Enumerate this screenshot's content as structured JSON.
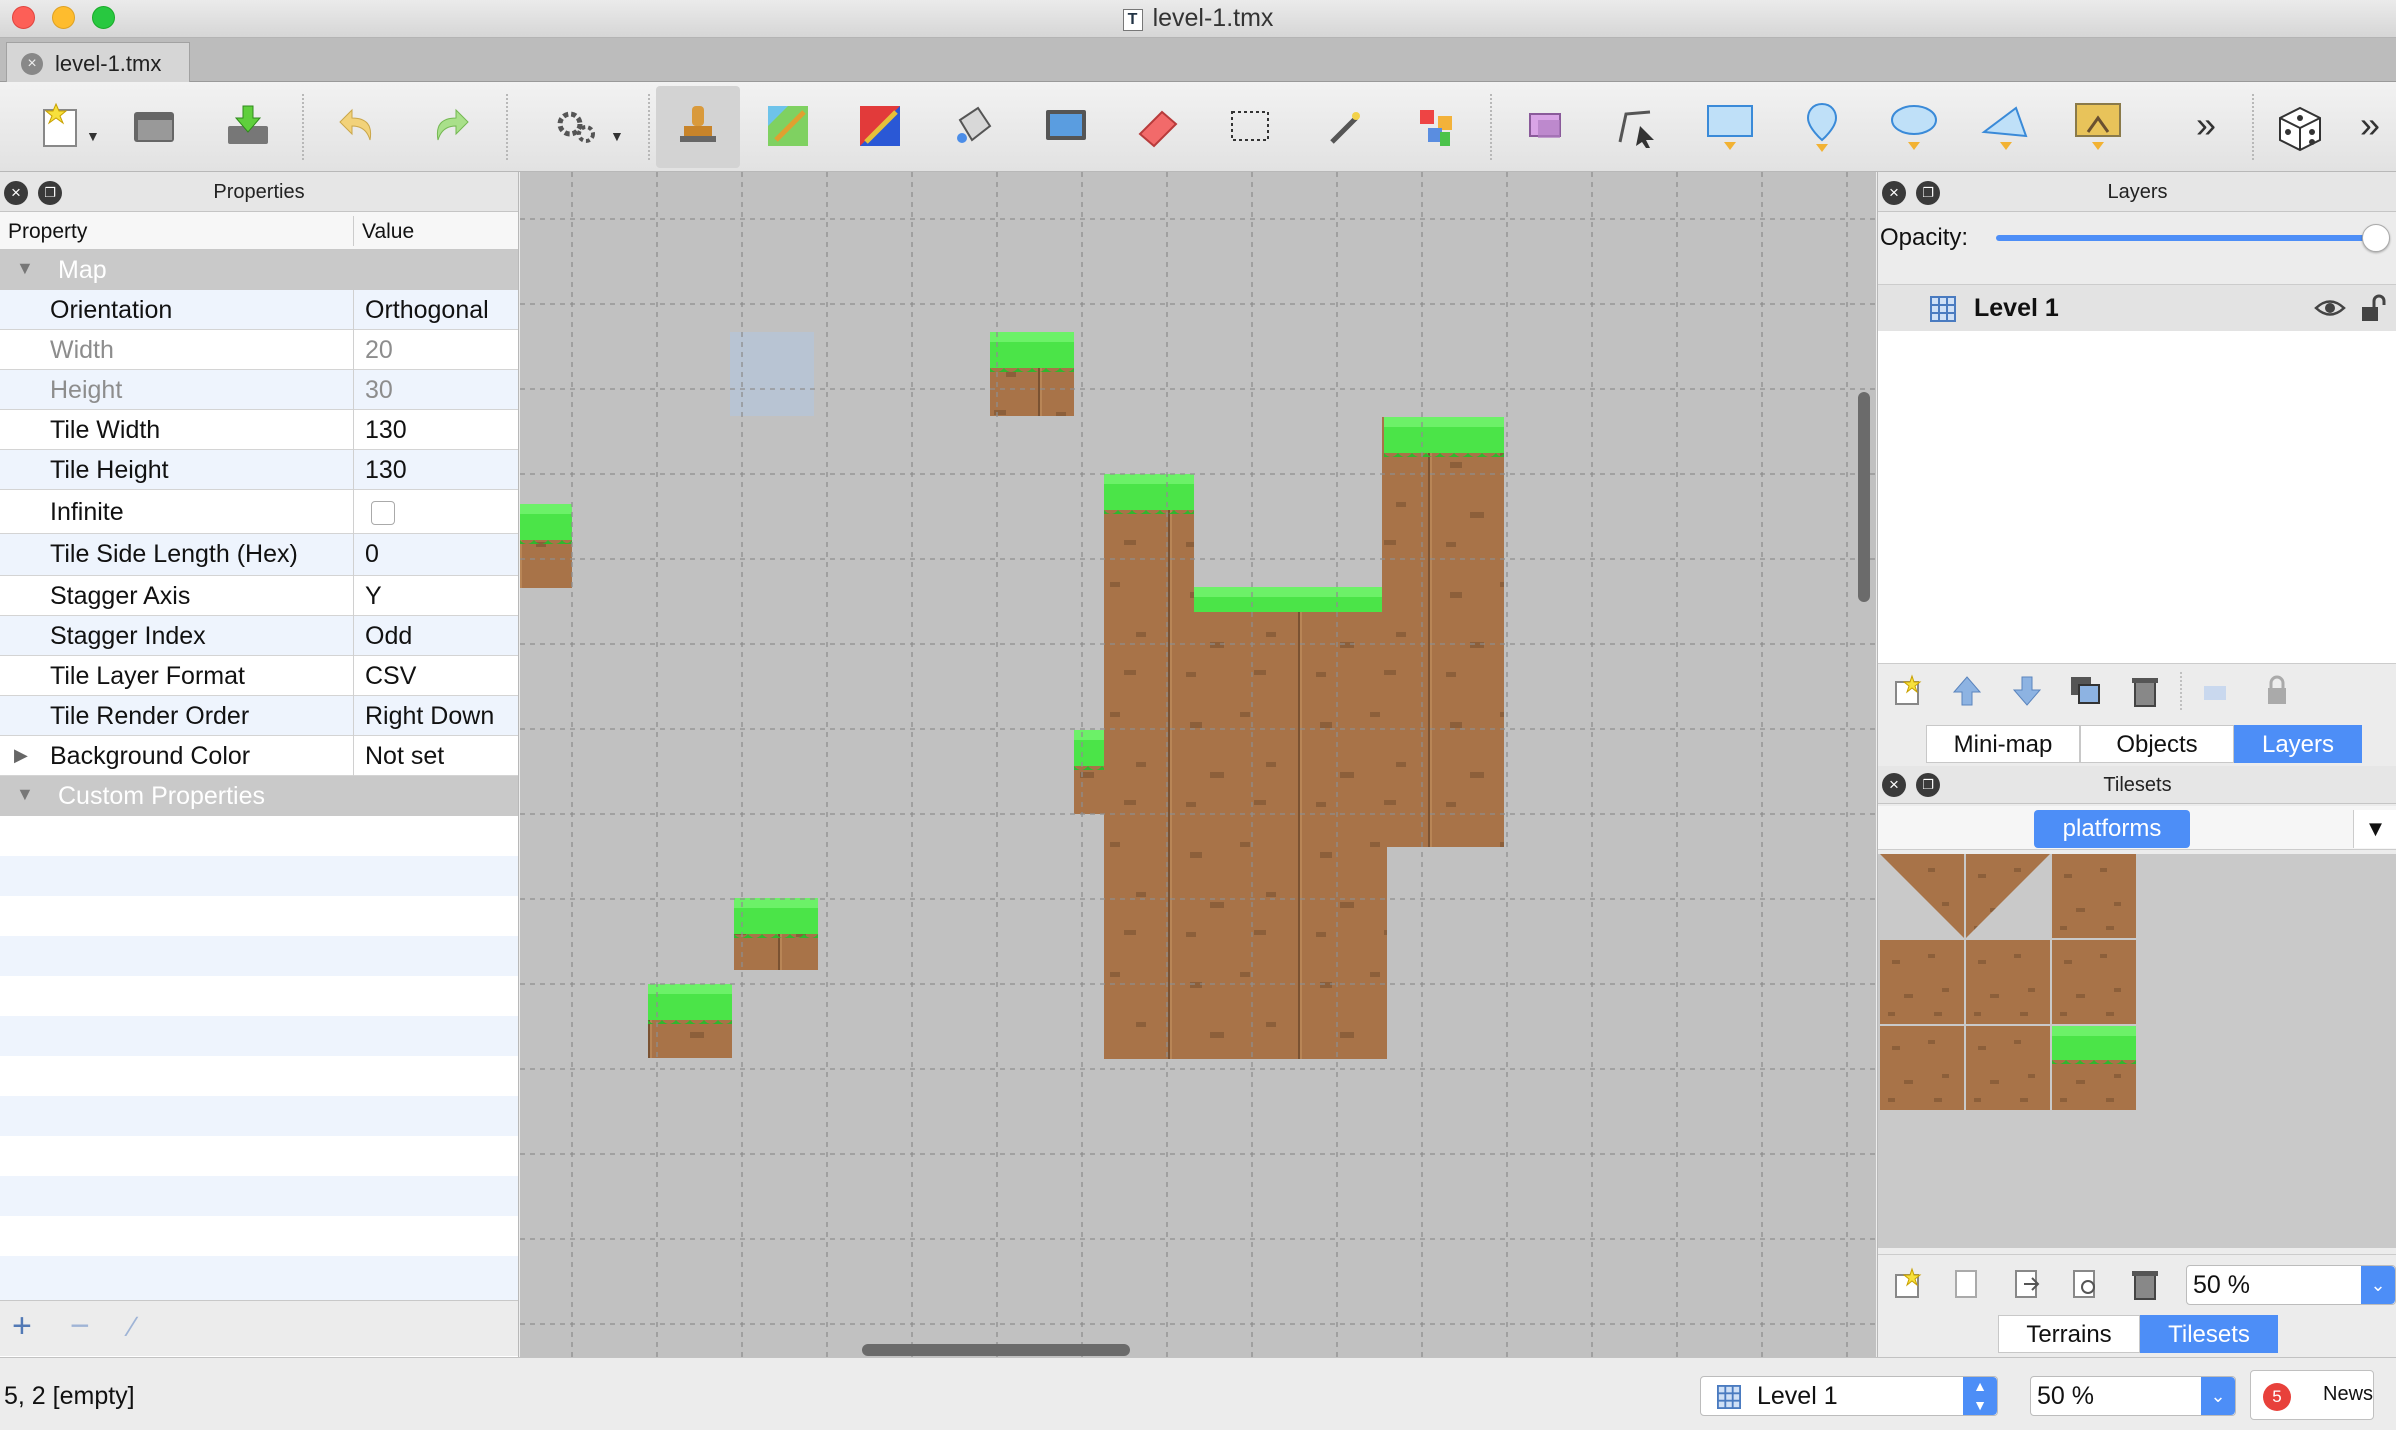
{
  "window": {
    "title": "level-1.tmx"
  },
  "tabs": [
    {
      "label": "level-1.tmx"
    }
  ],
  "toolbar": {
    "buttons": [
      "new-map-icon",
      "open-icon",
      "save-icon",
      "undo-icon",
      "redo-icon",
      "commands-icon",
      "stamp-brush-icon",
      "terrain-brush-icon",
      "wang-brush-icon",
      "bucket-fill-icon",
      "shape-fill-icon",
      "eraser-icon",
      "rectangular-select-icon",
      "magic-wand-icon",
      "select-same-tile-icon",
      "select-objects-icon",
      "edit-polygons-icon",
      "insert-rectangle-icon",
      "insert-point-icon",
      "insert-ellipse-icon",
      "insert-polygon-icon",
      "insert-tile-icon",
      "overflow-chevron-icon",
      "random-mode-icon",
      "overflow-chevron-icon"
    ],
    "active": "stamp-brush-icon"
  },
  "properties": {
    "title": "Properties",
    "columns": {
      "property": "Property",
      "value": "Value"
    },
    "groups": [
      {
        "name": "Map",
        "rows": [
          {
            "name": "Orientation",
            "value": "Orthogonal"
          },
          {
            "name": "Width",
            "value": "20"
          },
          {
            "name": "Height",
            "value": "30"
          },
          {
            "name": "Tile Width",
            "value": "130"
          },
          {
            "name": "Tile Height",
            "value": "130"
          },
          {
            "name": "Infinite",
            "value": ""
          },
          {
            "name": "Tile Side Length (Hex)",
            "value": "0"
          },
          {
            "name": "Stagger Axis",
            "value": "Y"
          },
          {
            "name": "Stagger Index",
            "value": "Odd"
          },
          {
            "name": "Tile Layer Format",
            "value": "CSV"
          },
          {
            "name": "Tile Render Order",
            "value": "Right Down"
          },
          {
            "name": "Background Color",
            "value": "Not set"
          }
        ]
      },
      {
        "name": "Custom Properties",
        "rows": []
      }
    ],
    "infinite_checked": false
  },
  "layers": {
    "title": "Layers",
    "opacity_label": "Opacity:",
    "opacity": 1.0,
    "items": [
      {
        "name": "Level 1",
        "visible": true,
        "locked": false
      }
    ],
    "tabs": [
      "Mini-map",
      "Objects",
      "Layers"
    ],
    "selected_tab": "Layers"
  },
  "tilesets": {
    "title": "Tilesets",
    "selected": "platforms",
    "zoom": "50 %",
    "tabs": [
      "Terrains",
      "Tilesets"
    ],
    "selected_tab": "Tilesets"
  },
  "status": {
    "text": "5, 2 [empty]",
    "layer": "Level 1",
    "zoom": "50 %",
    "news": "News",
    "news_count": "5"
  },
  "colors": {
    "accent": "#4d8ef7",
    "grass": "#4be448",
    "dirt": "#a87348",
    "canvas": "#c1c1c1"
  }
}
